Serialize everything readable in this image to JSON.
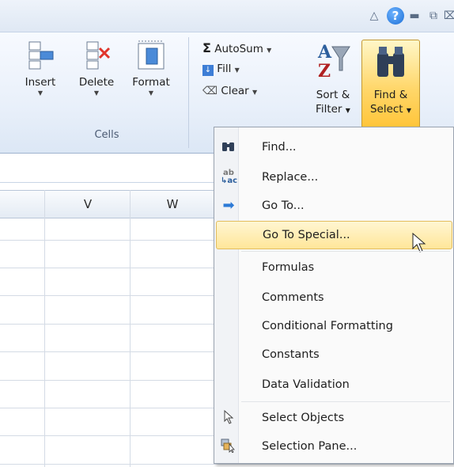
{
  "ribbon": {
    "cells_group": {
      "label": "Cells",
      "insert": "Insert",
      "delete": "Delete",
      "format": "Format"
    },
    "editing": {
      "autosum": "AutoSum",
      "fill": "Fill",
      "clear": "Clear",
      "sort_line1": "Sort &",
      "sort_line2": "Filter",
      "find_line1": "Find &",
      "find_line2": "Select"
    }
  },
  "grid": {
    "columns": [
      "V",
      "W"
    ]
  },
  "menu": {
    "items": [
      {
        "label": "Find...",
        "icon": "binoculars-icon"
      },
      {
        "label": "Replace...",
        "icon": "replace-icon"
      },
      {
        "label": "Go To...",
        "icon": "arrow-right-icon"
      },
      {
        "label": "Go To Special...",
        "icon": ""
      },
      {
        "label": "Formulas",
        "icon": ""
      },
      {
        "label": "Comments",
        "icon": ""
      },
      {
        "label": "Conditional Formatting",
        "icon": ""
      },
      {
        "label": "Constants",
        "icon": ""
      },
      {
        "label": "Data Validation",
        "icon": ""
      },
      {
        "label": "Select Objects",
        "icon": "pointer-icon"
      },
      {
        "label": "Selection Pane...",
        "icon": "selection-pane-icon"
      }
    ],
    "highlighted_index": 3
  },
  "colors": {
    "highlight": "#ffe69a",
    "accent": "#1c6fd6"
  }
}
